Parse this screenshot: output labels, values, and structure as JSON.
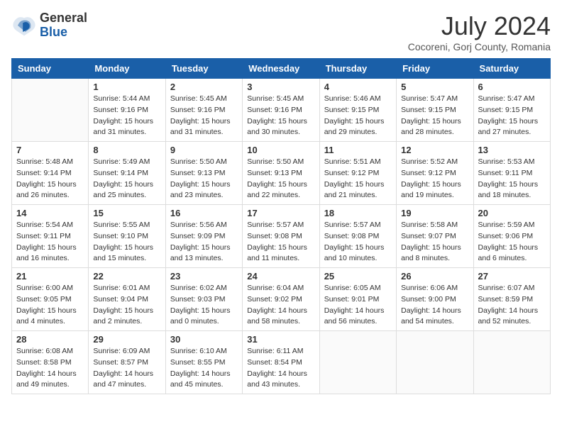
{
  "header": {
    "logo": {
      "general": "General",
      "blue": "Blue"
    },
    "title": "July 2024",
    "subtitle": "Cocoreni, Gorj County, Romania"
  },
  "weekdays": [
    "Sunday",
    "Monday",
    "Tuesday",
    "Wednesday",
    "Thursday",
    "Friday",
    "Saturday"
  ],
  "weeks": [
    [
      {
        "day": "",
        "sunrise": "",
        "sunset": "",
        "daylight": ""
      },
      {
        "day": "1",
        "sunrise": "Sunrise: 5:44 AM",
        "sunset": "Sunset: 9:16 PM",
        "daylight": "Daylight: 15 hours and 31 minutes."
      },
      {
        "day": "2",
        "sunrise": "Sunrise: 5:45 AM",
        "sunset": "Sunset: 9:16 PM",
        "daylight": "Daylight: 15 hours and 31 minutes."
      },
      {
        "day": "3",
        "sunrise": "Sunrise: 5:45 AM",
        "sunset": "Sunset: 9:16 PM",
        "daylight": "Daylight: 15 hours and 30 minutes."
      },
      {
        "day": "4",
        "sunrise": "Sunrise: 5:46 AM",
        "sunset": "Sunset: 9:15 PM",
        "daylight": "Daylight: 15 hours and 29 minutes."
      },
      {
        "day": "5",
        "sunrise": "Sunrise: 5:47 AM",
        "sunset": "Sunset: 9:15 PM",
        "daylight": "Daylight: 15 hours and 28 minutes."
      },
      {
        "day": "6",
        "sunrise": "Sunrise: 5:47 AM",
        "sunset": "Sunset: 9:15 PM",
        "daylight": "Daylight: 15 hours and 27 minutes."
      }
    ],
    [
      {
        "day": "7",
        "sunrise": "Sunrise: 5:48 AM",
        "sunset": "Sunset: 9:14 PM",
        "daylight": "Daylight: 15 hours and 26 minutes."
      },
      {
        "day": "8",
        "sunrise": "Sunrise: 5:49 AM",
        "sunset": "Sunset: 9:14 PM",
        "daylight": "Daylight: 15 hours and 25 minutes."
      },
      {
        "day": "9",
        "sunrise": "Sunrise: 5:50 AM",
        "sunset": "Sunset: 9:13 PM",
        "daylight": "Daylight: 15 hours and 23 minutes."
      },
      {
        "day": "10",
        "sunrise": "Sunrise: 5:50 AM",
        "sunset": "Sunset: 9:13 PM",
        "daylight": "Daylight: 15 hours and 22 minutes."
      },
      {
        "day": "11",
        "sunrise": "Sunrise: 5:51 AM",
        "sunset": "Sunset: 9:12 PM",
        "daylight": "Daylight: 15 hours and 21 minutes."
      },
      {
        "day": "12",
        "sunrise": "Sunrise: 5:52 AM",
        "sunset": "Sunset: 9:12 PM",
        "daylight": "Daylight: 15 hours and 19 minutes."
      },
      {
        "day": "13",
        "sunrise": "Sunrise: 5:53 AM",
        "sunset": "Sunset: 9:11 PM",
        "daylight": "Daylight: 15 hours and 18 minutes."
      }
    ],
    [
      {
        "day": "14",
        "sunrise": "Sunrise: 5:54 AM",
        "sunset": "Sunset: 9:11 PM",
        "daylight": "Daylight: 15 hours and 16 minutes."
      },
      {
        "day": "15",
        "sunrise": "Sunrise: 5:55 AM",
        "sunset": "Sunset: 9:10 PM",
        "daylight": "Daylight: 15 hours and 15 minutes."
      },
      {
        "day": "16",
        "sunrise": "Sunrise: 5:56 AM",
        "sunset": "Sunset: 9:09 PM",
        "daylight": "Daylight: 15 hours and 13 minutes."
      },
      {
        "day": "17",
        "sunrise": "Sunrise: 5:57 AM",
        "sunset": "Sunset: 9:08 PM",
        "daylight": "Daylight: 15 hours and 11 minutes."
      },
      {
        "day": "18",
        "sunrise": "Sunrise: 5:57 AM",
        "sunset": "Sunset: 9:08 PM",
        "daylight": "Daylight: 15 hours and 10 minutes."
      },
      {
        "day": "19",
        "sunrise": "Sunrise: 5:58 AM",
        "sunset": "Sunset: 9:07 PM",
        "daylight": "Daylight: 15 hours and 8 minutes."
      },
      {
        "day": "20",
        "sunrise": "Sunrise: 5:59 AM",
        "sunset": "Sunset: 9:06 PM",
        "daylight": "Daylight: 15 hours and 6 minutes."
      }
    ],
    [
      {
        "day": "21",
        "sunrise": "Sunrise: 6:00 AM",
        "sunset": "Sunset: 9:05 PM",
        "daylight": "Daylight: 15 hours and 4 minutes."
      },
      {
        "day": "22",
        "sunrise": "Sunrise: 6:01 AM",
        "sunset": "Sunset: 9:04 PM",
        "daylight": "Daylight: 15 hours and 2 minutes."
      },
      {
        "day": "23",
        "sunrise": "Sunrise: 6:02 AM",
        "sunset": "Sunset: 9:03 PM",
        "daylight": "Daylight: 15 hours and 0 minutes."
      },
      {
        "day": "24",
        "sunrise": "Sunrise: 6:04 AM",
        "sunset": "Sunset: 9:02 PM",
        "daylight": "Daylight: 14 hours and 58 minutes."
      },
      {
        "day": "25",
        "sunrise": "Sunrise: 6:05 AM",
        "sunset": "Sunset: 9:01 PM",
        "daylight": "Daylight: 14 hours and 56 minutes."
      },
      {
        "day": "26",
        "sunrise": "Sunrise: 6:06 AM",
        "sunset": "Sunset: 9:00 PM",
        "daylight": "Daylight: 14 hours and 54 minutes."
      },
      {
        "day": "27",
        "sunrise": "Sunrise: 6:07 AM",
        "sunset": "Sunset: 8:59 PM",
        "daylight": "Daylight: 14 hours and 52 minutes."
      }
    ],
    [
      {
        "day": "28",
        "sunrise": "Sunrise: 6:08 AM",
        "sunset": "Sunset: 8:58 PM",
        "daylight": "Daylight: 14 hours and 49 minutes."
      },
      {
        "day": "29",
        "sunrise": "Sunrise: 6:09 AM",
        "sunset": "Sunset: 8:57 PM",
        "daylight": "Daylight: 14 hours and 47 minutes."
      },
      {
        "day": "30",
        "sunrise": "Sunrise: 6:10 AM",
        "sunset": "Sunset: 8:55 PM",
        "daylight": "Daylight: 14 hours and 45 minutes."
      },
      {
        "day": "31",
        "sunrise": "Sunrise: 6:11 AM",
        "sunset": "Sunset: 8:54 PM",
        "daylight": "Daylight: 14 hours and 43 minutes."
      },
      {
        "day": "",
        "sunrise": "",
        "sunset": "",
        "daylight": ""
      },
      {
        "day": "",
        "sunrise": "",
        "sunset": "",
        "daylight": ""
      },
      {
        "day": "",
        "sunrise": "",
        "sunset": "",
        "daylight": ""
      }
    ]
  ]
}
